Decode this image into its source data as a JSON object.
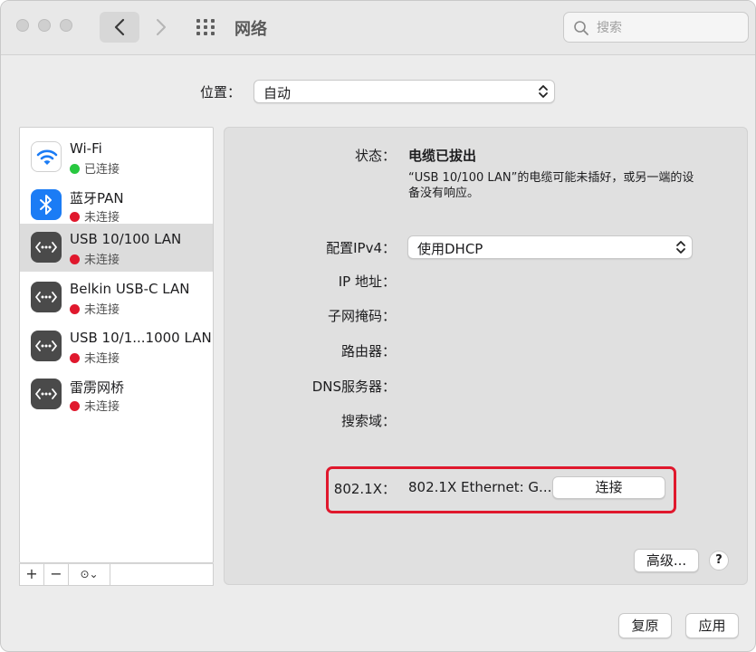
{
  "window": {
    "title": "网络",
    "search_placeholder": "搜索"
  },
  "location": {
    "label": "位置：",
    "value": "自动"
  },
  "sidebar": {
    "items": [
      {
        "name": "Wi-Fi",
        "status": "已连接",
        "status_color": "#28c840",
        "icon": "wifi-icon"
      },
      {
        "name": "蓝牙PAN",
        "status": "未连接",
        "status_color": "#e0182d",
        "icon": "bluetooth-icon"
      },
      {
        "name": "USB 10/100 LAN",
        "status": "未连接",
        "status_color": "#e0182d",
        "icon": "ethernet-icon",
        "selected": true
      },
      {
        "name": "Belkin USB-C LAN",
        "status": "未连接",
        "status_color": "#e0182d",
        "icon": "ethernet-icon"
      },
      {
        "name": "USB 10/1...1000 LAN",
        "status": "未连接",
        "status_color": "#e0182d",
        "icon": "ethernet-icon"
      },
      {
        "name": "雷雳网桥",
        "status": "未连接",
        "status_color": "#e0182d",
        "icon": "ethernet-icon"
      }
    ],
    "footer": {
      "add": "+",
      "remove": "−",
      "more": "⊙⌄"
    }
  },
  "detail": {
    "status_label": "状态：",
    "status_value": "电缆已拔出",
    "status_desc": "“USB 10/100 LAN”的电缆可能未插好，或另一端的设备没有响应。",
    "ipv4_label": "配置IPv4：",
    "ipv4_value": "使用DHCP",
    "ip_label": "IP 地址：",
    "subnet_label": "子网掩码：",
    "router_label": "路由器：",
    "dns_label": "DNS服务器：",
    "search_domain_label": "搜索域：",
    "x8021_label": "802.1X：",
    "x8021_value": "802.1X Ethernet: G...",
    "connect_button": "连接",
    "advanced_button": "高级...",
    "help_button": "?"
  },
  "footer": {
    "revert_button": "复原",
    "apply_button": "应用"
  },
  "colors": {
    "accent_blue": "#1b7cf5",
    "connected_green": "#28c840",
    "disconnected_red": "#e0182d",
    "highlight_red": "#e0182d"
  }
}
